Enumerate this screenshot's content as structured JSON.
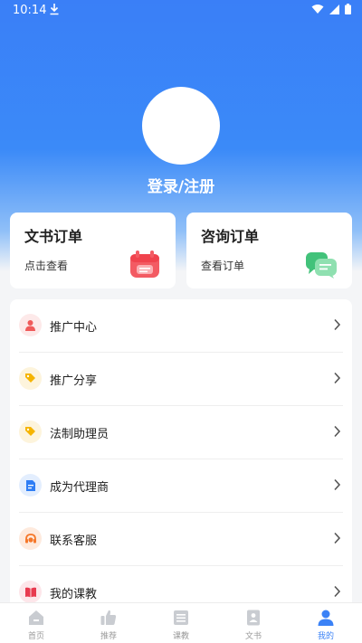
{
  "status_bar": {
    "time": "10:14"
  },
  "profile": {
    "login_label": "登录/注册"
  },
  "orders": [
    {
      "title": "文书订单",
      "subtitle": "点击查看"
    },
    {
      "title": "咨询订单",
      "subtitle": "查看订单"
    }
  ],
  "menu": [
    {
      "label": "推广中心",
      "icon": "user-icon",
      "color": "#f05a5a",
      "bg": "#fde9e9"
    },
    {
      "label": "推广分享",
      "icon": "tag-icon",
      "color": "#f5b400",
      "bg": "#fdf4dc"
    },
    {
      "label": "法制助理员",
      "icon": "tag-icon",
      "color": "#f5b400",
      "bg": "#fdf4dc"
    },
    {
      "label": "成为代理商",
      "icon": "document-icon",
      "color": "#2f7ef5",
      "bg": "#e3eefe"
    },
    {
      "label": "联系客服",
      "icon": "headset-icon",
      "color": "#f5782a",
      "bg": "#feeadd"
    },
    {
      "label": "我的课教",
      "icon": "book-icon",
      "color": "#e83a4f",
      "bg": "#fde6ea"
    }
  ],
  "tabs": [
    {
      "label": "首页",
      "icon": "home-icon",
      "active": false
    },
    {
      "label": "推荐",
      "icon": "thumbs-up-icon",
      "active": false
    },
    {
      "label": "课教",
      "icon": "list-icon",
      "active": false
    },
    {
      "label": "文书",
      "icon": "document-icon",
      "active": false
    },
    {
      "label": "我的",
      "icon": "person-icon",
      "active": true
    }
  ],
  "colors": {
    "accent": "#3b82f6",
    "header": "#3a7ff7"
  }
}
